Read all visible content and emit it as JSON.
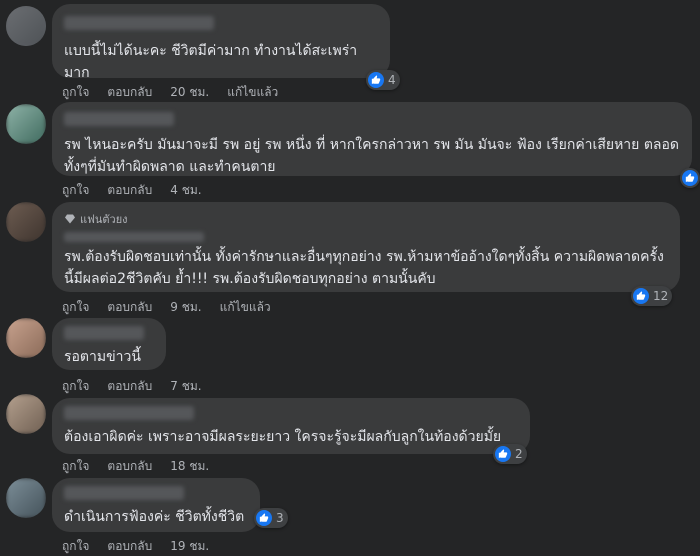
{
  "comments": [
    {
      "text": "แบบนี้ไม่ได้นะคะ ชีวิตมีค่ามาก ทำงานได้สะเพร่ามาก",
      "like_label": "ถูกใจ",
      "reply_label": "ตอบกลับ",
      "time": "20 ชม.",
      "edited": "แก้ไขแล้ว",
      "reactions": "4"
    },
    {
      "text": "รพ ไหนอะครับ มันมาจะมี รพ อยู่ รพ หนึ่ง ที่ หากใครกล่าวหา รพ มัน มันจะ ฟ้อง เรียกค่าเสียหาย ตลอด ทั้งๆที่มันทำผิดพลาด และทำคนตาย",
      "like_label": "ถูกใจ",
      "reply_label": "ตอบกลับ",
      "time": "4 ชม.",
      "reactions": ""
    },
    {
      "badge": "แฟนตัวยง",
      "text": "รพ.ต้องรับผิดชอบเท่านั้น ทั้งค่ารักษาและอื่นๆทุกอย่าง รพ.ห้ามหาข้ออ้างใดๆทั้งสิ้น ความผิดพลาดครั้งนี้มีผลต่อ2ชีวิตคับ ย้ำ!!! รพ.ต้องรับผิดชอบทุกอย่าง ตามนั้นคับ",
      "like_label": "ถูกใจ",
      "reply_label": "ตอบกลับ",
      "time": "9 ชม.",
      "edited": "แก้ไขแล้ว",
      "reactions": "12"
    },
    {
      "text": "รอตามข่าวนี้",
      "like_label": "ถูกใจ",
      "reply_label": "ตอบกลับ",
      "time": "7 ชม."
    },
    {
      "text": "ต้องเอาผิดค่ะ เพราะอาจมีผลระยะยาว ใครจะรู้จะมีผลกับลูกในท้องด้วยมั้ย",
      "like_label": "ถูกใจ",
      "reply_label": "ตอบกลับ",
      "time": "18 ชม.",
      "reactions": "2"
    },
    {
      "text": "ดำเนินการฟ้องค่ะ ชีวิตทั้งชีวิต",
      "like_label": "ถูกใจ",
      "reply_label": "ตอบกลับ",
      "time": "19 ชม.",
      "reactions": "3"
    }
  ],
  "colors": {
    "background": "#242526",
    "bubble": "#3a3b3c",
    "like": "#1877f2"
  },
  "icons": {
    "reaction": "thumbs-up-icon",
    "badge": "diamond-icon"
  }
}
